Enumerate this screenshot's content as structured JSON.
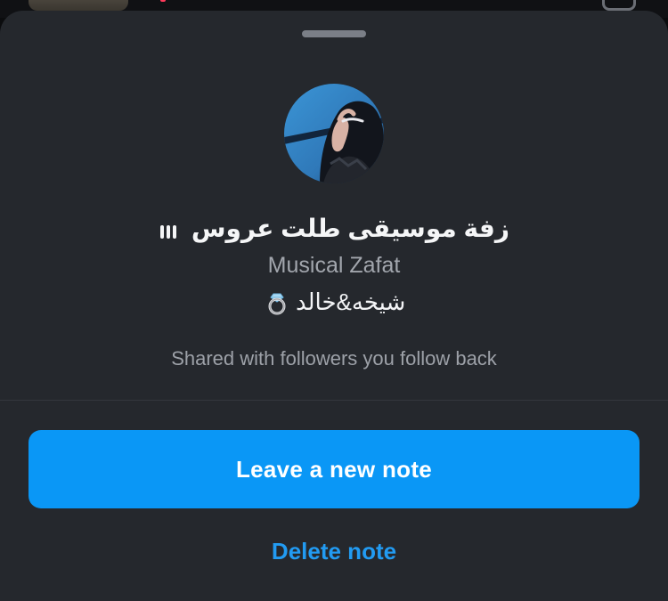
{
  "note": {
    "text": "زفة موسيقى طلت عروس",
    "music_label": "Musical Zafat",
    "artist_text": "شيخه&خالد",
    "audience_text": "Shared with followers you follow back"
  },
  "actions": {
    "leave_note_label": "Leave a new note",
    "delete_note_label": "Delete note"
  },
  "colors": {
    "sheet_background": "#25282d",
    "primary_button": "#0a97f6",
    "link": "#229bf2"
  },
  "icons": {
    "music": "music-bars-icon",
    "artist_emoji": "ring-icon"
  }
}
